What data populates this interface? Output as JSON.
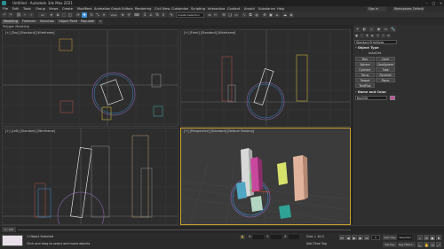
{
  "window": {
    "title": "Untitled - Autodesk 3ds Max 2021"
  },
  "menu": [
    "File",
    "Edit",
    "Tools",
    "Group",
    "Views",
    "Create",
    "Modifiers",
    "Animation",
    "Graph Editors",
    "Rendering",
    "Civil View",
    "Customize",
    "Scripting",
    "Interactive",
    "Content",
    "Arnold",
    "Substance",
    "Help"
  ],
  "signin": "Sign In",
  "workspace": "Workspaces: Default",
  "selection_set": "Create Selection Se",
  "ribbon": {
    "tabs": [
      "Modeling",
      "Freeform",
      "Selection",
      "Object Paint",
      "Populate"
    ]
  },
  "subtitle": "Polygon Modeling",
  "viewports": {
    "top": "[+] [Top] [Standard] [Wireframe]",
    "front": "[+] [Front] [Standard] [Wireframe]",
    "left": "[+] [Left] [Standard] [Wireframe]",
    "perspective": "[+] [Perspective] [Standard] [Default Shading]"
  },
  "command_panel": {
    "category": "Standard Primitives",
    "object_type_header": "- Object Type",
    "autogrid": "AutoGrid",
    "buttons": [
      "Box",
      "Cone",
      "Sphere",
      "GeoSphere",
      "Cylinder",
      "Tube",
      "Torus",
      "Pyramid",
      "Teapot",
      "Plane",
      "TextPlus"
    ],
    "name_color_header": "- Name and Color",
    "name_value": "Box006"
  },
  "timeline": {
    "frame": "0 / 100",
    "ticks": [
      "0",
      "5",
      "10",
      "15",
      "20",
      "25",
      "30",
      "35",
      "40",
      "45",
      "50",
      "55",
      "60",
      "65",
      "70",
      "75",
      "80",
      "85",
      "90",
      "95",
      "100"
    ]
  },
  "status": {
    "selected": "1 Object Selected",
    "prompt": "Click and drag to select and move objects",
    "x": "X:",
    "y": "Y:",
    "z": "Z:",
    "grid": "Grid = 10.0",
    "add_time_tag": "Add Time Tag",
    "auto_key": "Auto Key",
    "selected_dd": "Selected",
    "set_key": "Set Key",
    "key_filters": "Key Filters...",
    "maxscript": "MAXScript Mi",
    "frame": "0"
  },
  "colors": {
    "accent": "#c8a12a",
    "selection": "#3a8fd8"
  }
}
